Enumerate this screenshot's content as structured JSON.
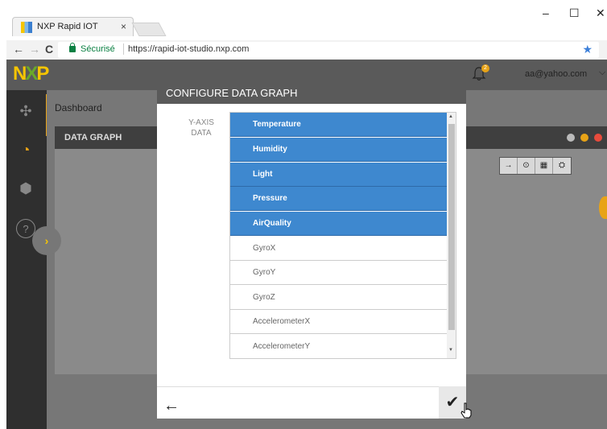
{
  "browser": {
    "tab_title": "NXP Rapid IOT",
    "tab_close": "×",
    "window_controls": {
      "minimize": "–",
      "maximize": "☐",
      "close": "✕"
    },
    "nav": {
      "back": "←",
      "forward": "→",
      "reload": "C"
    },
    "secure_label": "Sécurisé",
    "url": "https://rapid-iot-studio.nxp.com",
    "bookmark_icon": "★",
    "menu_icon": "⋮"
  },
  "app": {
    "logo": {
      "n": "N",
      "x": "X",
      "p": "P"
    },
    "notification_count": "2",
    "user_email": "aa@yahoo.com",
    "user_caret": "⌵",
    "breadcrumb": "Dashboard",
    "panel_title": "DATA GRAPH",
    "toolbar": [
      "→",
      "⊙",
      "▦",
      "⛭"
    ],
    "sidebar_icons": [
      "✣",
      "◔",
      "⬢",
      "?"
    ],
    "expander": "›",
    "status_colors": {
      "grey": "#bbbbbb",
      "orange": "#e8a317",
      "red": "#e84b3c"
    }
  },
  "modal": {
    "title": "CONFIGURE DATA GRAPH",
    "yaxis_label_line1": "Y-AXIS",
    "yaxis_label_line2": "DATA",
    "items": [
      {
        "label": "Temperature",
        "selected": true
      },
      {
        "label": "Humidity",
        "selected": true
      },
      {
        "label": "Light",
        "selected": true
      },
      {
        "label": "Pressure",
        "selected": true
      },
      {
        "label": "AirQuality",
        "selected": true
      },
      {
        "label": "GyroX",
        "selected": false
      },
      {
        "label": "GyroY",
        "selected": false
      },
      {
        "label": "GyroZ",
        "selected": false
      },
      {
        "label": "AccelerometerX",
        "selected": false
      },
      {
        "label": "AccelerometerY",
        "selected": false
      }
    ],
    "back_icon": "🡐",
    "confirm_icon": "✔"
  },
  "colors": {
    "accent": "#3e88cf",
    "brand_yellow": "#f6c500",
    "brand_green": "#6aa92a"
  }
}
